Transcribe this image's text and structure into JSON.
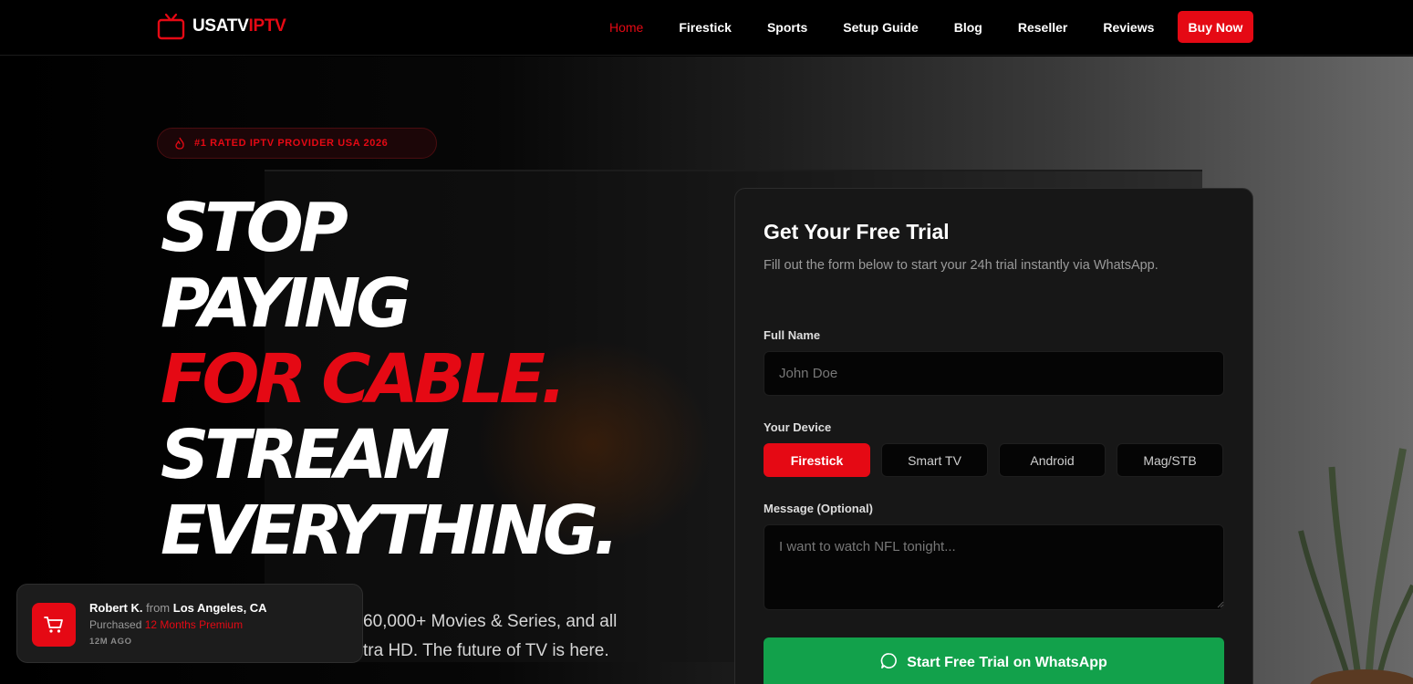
{
  "brand": {
    "name_white": "USATV",
    "name_red": "IPTV",
    "icon": "tv-icon",
    "accent": "#e50914"
  },
  "nav": {
    "links": [
      "Home",
      "Firestick",
      "Sports",
      "Setup Guide",
      "Blog",
      "Reseller",
      "Reviews"
    ],
    "active": "Home",
    "cta": "Buy Now"
  },
  "hero": {
    "badge": "#1 RATED IPTV PROVIDER USA 2026",
    "badge_icon": "flame-icon",
    "headline": {
      "line1": "STOP",
      "line2": "PAYING",
      "line3": "FOR CABLE.",
      "line4": "STREAM",
      "line5": "EVERYTHING."
    },
    "sub_line1": "60,000+ Movies & Series, and all",
    "sub_line2": "tra HD. The future of TV is here."
  },
  "form": {
    "title": "Get Your Free Trial",
    "description": "Fill out the form below to start your 24h trial instantly via WhatsApp.",
    "name_label": "Full Name",
    "name_placeholder": "John Doe",
    "device_label": "Your Device",
    "devices": [
      "Firestick",
      "Smart TV",
      "Android",
      "Mag/STB"
    ],
    "selected_device": "Firestick",
    "message_label": "Message (Optional)",
    "message_placeholder": "I want to watch NFL tonight...",
    "submit_label": "Start Free Trial on WhatsApp",
    "submit_icon": "whatsapp-icon",
    "submit_color": "#12a14b"
  },
  "toast": {
    "name": "Robert K.",
    "from_word": "from",
    "location": "Los Angeles, CA",
    "purchased_word": "Purchased",
    "plan": "12 Months Premium",
    "time": "12M AGO",
    "icon": "cart-icon"
  }
}
